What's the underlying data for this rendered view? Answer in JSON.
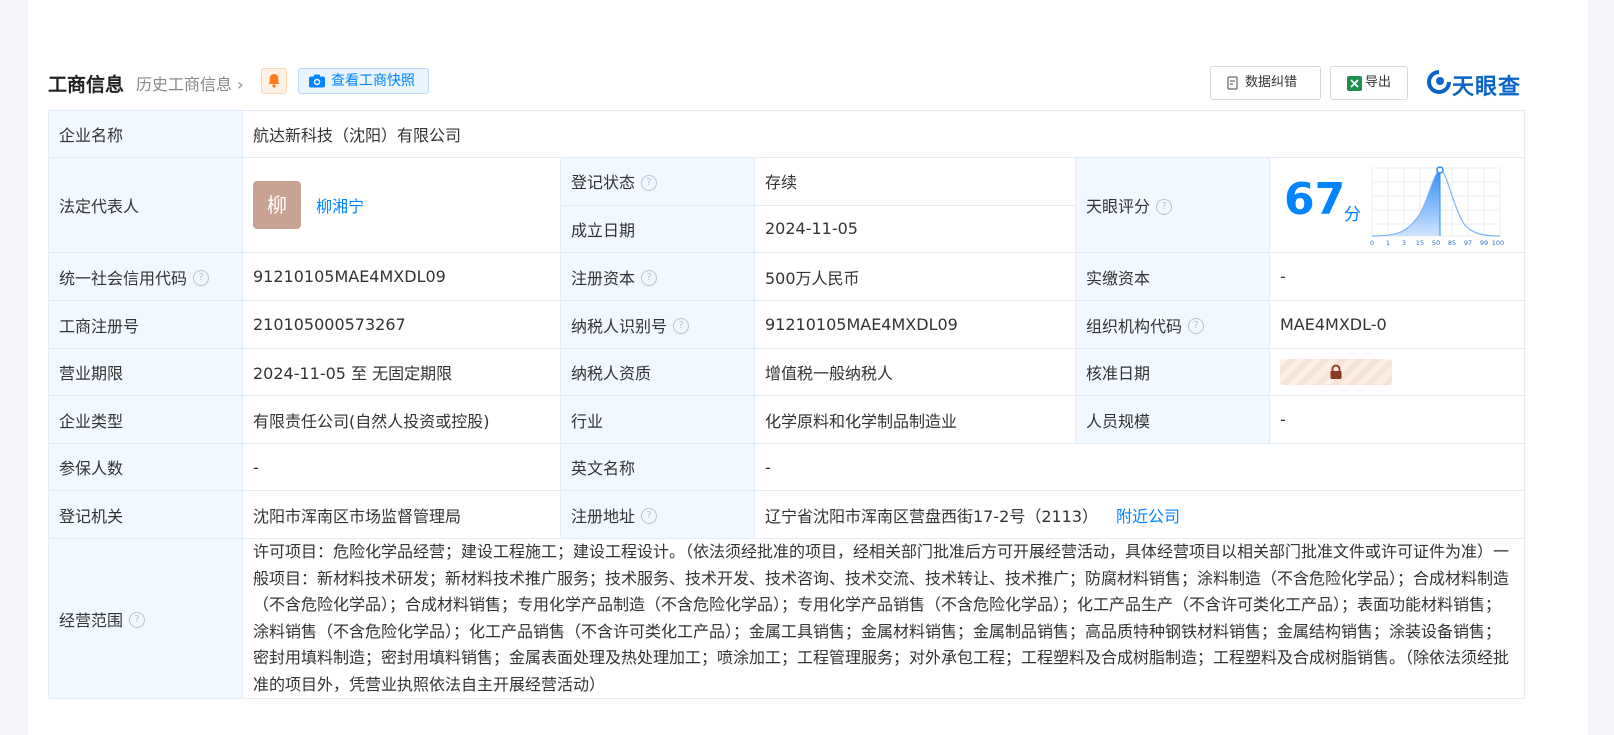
{
  "header": {
    "title": "工商信息",
    "history_label": "历史工商信息",
    "snapshot_label": "查看工商快照",
    "correction_label": "数据纠错",
    "export_label": "导出",
    "brand": "天眼查"
  },
  "company": {
    "name_label": "企业名称",
    "name": "航达新科技（沈阳）有限公司",
    "legal_rep_label": "法定代表人",
    "legal_rep_avatar": "柳",
    "legal_rep": "柳湘宁",
    "status_label": "登记状态",
    "status": "存续",
    "founded_label": "成立日期",
    "founded": "2024-11-05",
    "score_label": "天眼评分",
    "score": "67",
    "score_unit": "分",
    "score_axis": [
      "0",
      "1",
      "3",
      "15",
      "50",
      "85",
      "97",
      "99",
      "100"
    ],
    "credit_code_label": "统一社会信用代码",
    "credit_code": "91210105MAE4MXDL09",
    "reg_capital_label": "注册资本",
    "reg_capital": "500万人民币",
    "paid_capital_label": "实缴资本",
    "paid_capital": "-",
    "reg_no_label": "工商注册号",
    "reg_no": "210105000573267",
    "taxpayer_id_label": "纳税人识别号",
    "taxpayer_id": "91210105MAE4MXDL09",
    "org_code_label": "组织机构代码",
    "org_code": "MAE4MXDL-0",
    "term_label": "营业期限",
    "term": "2024-11-05 至 无固定期限",
    "taxpayer_qual_label": "纳税人资质",
    "taxpayer_qual": "增值税一般纳税人",
    "approval_date_label": "核准日期",
    "type_label": "企业类型",
    "type": "有限责任公司(自然人投资或控股)",
    "industry_label": "行业",
    "industry": "化学原料和化学制品制造业",
    "staff_size_label": "人员规模",
    "staff_size": "-",
    "insured_label": "参保人数",
    "insured": "-",
    "english_name_label": "英文名称",
    "english_name": "-",
    "authority_label": "登记机关",
    "authority": "沈阳市浑南区市场监督管理局",
    "address_label": "注册地址",
    "address": "辽宁省沈阳市浑南区营盘西街17-2号（2113）",
    "nearby_label": "附近公司",
    "scope_label": "经营范围",
    "scope": "许可项目：危险化学品经营；建设工程施工；建设工程设计。（依法须经批准的项目，经相关部门批准后方可开展经营活动，具体经营项目以相关部门批准文件或许可证件为准）一般项目：新材料技术研发；新材料技术推广服务；技术服务、技术开发、技术咨询、技术交流、技术转让、技术推广；防腐材料销售；涂料制造（不含危险化学品）；合成材料制造（不含危险化学品）；合成材料销售；专用化学产品制造（不含危险化学品）；专用化学产品销售（不含危险化学品）；化工产品生产（不含许可类化工产品）；表面功能材料销售；涂料销售（不含危险化学品）；化工产品销售（不含许可类化工产品）；金属工具销售；金属材料销售；金属制品销售；高品质特种钢铁材料销售；金属结构销售；涂装设备销售；密封用填料制造；密封用填料销售；金属表面处理及热处理加工；喷涂加工；工程管理服务；对外承包工程；工程塑料及合成树脂制造；工程塑料及合成树脂销售。（除依法须经批准的项目外，凭营业执照依法自主开展经营活动）"
  },
  "colors": {
    "accent": "#0084ff",
    "status_green": "#18a058",
    "label_bg": "#f2f8ff"
  }
}
